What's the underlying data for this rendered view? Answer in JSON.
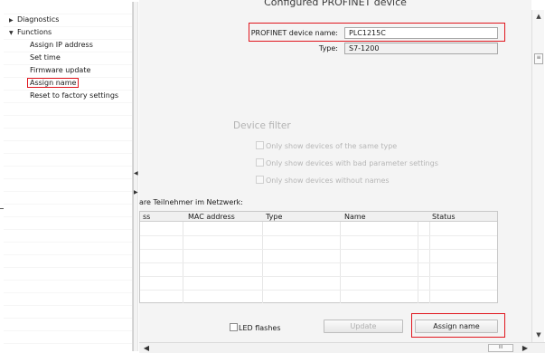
{
  "tree": {
    "items": [
      {
        "label": "Diagnostics",
        "arrow": "▶"
      },
      {
        "label": "Functions",
        "arrow": "▼"
      },
      {
        "label": "Assign IP address"
      },
      {
        "label": "Set time"
      },
      {
        "label": "Firmware update"
      },
      {
        "label": "Assign name"
      },
      {
        "label": "Reset to factory settings"
      }
    ]
  },
  "panel": {
    "section_title": "Configured PROFINET device",
    "device_name_label": "PROFINET device name:",
    "device_name_value": "PLC1215C",
    "type_label": "Type:",
    "type_value": "S7-1200",
    "filter": {
      "title": "Device filter",
      "options": [
        "Only show devices of the same type",
        "Only show devices with bad parameter settings",
        "Only show devices without names"
      ]
    },
    "network_label": "are Teilnehmer im Netzwerk:",
    "table": {
      "columns": [
        "ss",
        "MAC address",
        "Type",
        "Name",
        "Status"
      ]
    },
    "led_label": "LED flashes",
    "update_label": "Update",
    "assign_label": "Assign name"
  },
  "scroll": {
    "up": "▲",
    "down": "▼",
    "left": "◀",
    "right": "▶",
    "grip_v": "≡",
    "grip_h": "III"
  },
  "colors": {
    "highlight": "#e0161e",
    "panel_bg": "#f4f4f4",
    "disabled_text": "#b6b6b6"
  }
}
